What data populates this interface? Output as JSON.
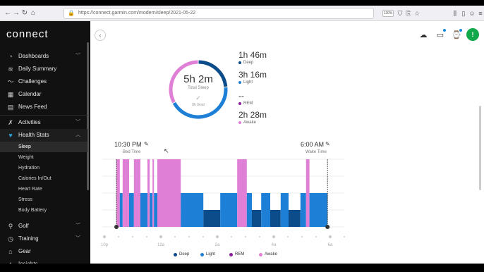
{
  "browser": {
    "url": "https://connect.garmin.com/modern/sleep/2021-05-22",
    "zoom": "130%"
  },
  "app": {
    "logo": "connect"
  },
  "sidebar": {
    "items": [
      {
        "label": "Dashboards",
        "icon": "gauge-icon",
        "glyph": "◔",
        "chevron": true
      },
      {
        "label": "Daily Summary",
        "icon": "layers-icon",
        "glyph": "≋",
        "chevron": false
      },
      {
        "label": "Challenges",
        "icon": "challenge-icon",
        "glyph": "〜",
        "chevron": false
      },
      {
        "label": "Calendar",
        "icon": "calendar-icon",
        "glyph": "▦",
        "chevron": false
      },
      {
        "label": "News Feed",
        "icon": "newsfeed-icon",
        "glyph": "▤",
        "chevron": false
      },
      {
        "label": "Activities",
        "icon": "runner-icon",
        "glyph": "✗",
        "chevron": true
      },
      {
        "label": "Health Stats",
        "icon": "heart-icon",
        "glyph": "♥",
        "chevron": true,
        "expanded": true
      }
    ],
    "health_sub": [
      "Sleep",
      "Weight",
      "Hydration",
      "Calories In/Out",
      "Heart Rate",
      "Stress",
      "Body Battery"
    ],
    "bottom_items": [
      {
        "label": "Golf",
        "icon": "golf-icon",
        "glyph": "⚲",
        "chevron": true
      },
      {
        "label": "Training",
        "icon": "stopwatch-icon",
        "glyph": "◷",
        "chevron": true
      },
      {
        "label": "Gear",
        "icon": "shoe-icon",
        "glyph": "⌂",
        "chevron": false
      },
      {
        "label": "Insights",
        "icon": "insights-icon",
        "glyph": "✦",
        "chevron": false
      }
    ]
  },
  "summary": {
    "total": "5h 2m",
    "total_label": "Total Sleep",
    "goal_label": "8h Goal",
    "stats": [
      {
        "value": "1h 46m",
        "label": "Deep",
        "color": "#0d4c8b"
      },
      {
        "value": "3h 16m",
        "label": "Light",
        "color": "#1e7fd6"
      },
      {
        "value": "--",
        "label": "REM",
        "color": "#8a1d9b"
      },
      {
        "value": "2h 28m",
        "label": "Awake",
        "color": "#e07fd6"
      }
    ],
    "ring": {
      "deep_min": 106,
      "light_min": 196,
      "rem_min": 0,
      "awake_min": 148
    }
  },
  "sleep_chart": {
    "bed_time": "10:30 PM",
    "bed_label": "Bed Time",
    "wake_time": "6:00 AM",
    "wake_label": "Wake Time",
    "x_ticks": [
      "10p",
      "12a",
      "2a",
      "4a",
      "6a"
    ],
    "legend": [
      {
        "label": "Deep",
        "color": "#0d4c8b"
      },
      {
        "label": "Light",
        "color": "#1e7fd6"
      },
      {
        "label": "REM",
        "color": "#8a1d9b"
      },
      {
        "label": "Awake",
        "color": "#e07fd6"
      }
    ]
  },
  "chart_data": {
    "type": "bar",
    "title": "",
    "x_unit": "hours after 10:00 PM",
    "stages": {
      "deep": 1,
      "light": 2,
      "rem": 3,
      "awake": 4
    },
    "segments": [
      {
        "start": 0.5,
        "end": 0.62,
        "stage": "awake"
      },
      {
        "start": 0.62,
        "end": 0.72,
        "stage": "light"
      },
      {
        "start": 0.72,
        "end": 0.95,
        "stage": "awake"
      },
      {
        "start": 0.95,
        "end": 1.12,
        "stage": "light"
      },
      {
        "start": 1.12,
        "end": 1.35,
        "stage": "awake"
      },
      {
        "start": 1.35,
        "end": 1.6,
        "stage": "light"
      },
      {
        "start": 1.6,
        "end": 1.68,
        "stage": "awake"
      },
      {
        "start": 1.68,
        "end": 1.78,
        "stage": "light"
      },
      {
        "start": 1.78,
        "end": 1.83,
        "stage": "awake"
      },
      {
        "start": 1.83,
        "end": 1.95,
        "stage": "light"
      },
      {
        "start": 1.95,
        "end": 2.78,
        "stage": "awake"
      },
      {
        "start": 2.78,
        "end": 3.58,
        "stage": "light"
      },
      {
        "start": 3.58,
        "end": 4.18,
        "stage": "deep"
      },
      {
        "start": 4.18,
        "end": 4.78,
        "stage": "light"
      },
      {
        "start": 4.78,
        "end": 5.12,
        "stage": "awake"
      },
      {
        "start": 5.12,
        "end": 5.3,
        "stage": "light"
      },
      {
        "start": 5.3,
        "end": 5.63,
        "stage": "deep"
      },
      {
        "start": 5.63,
        "end": 5.95,
        "stage": "light"
      },
      {
        "start": 5.95,
        "end": 6.32,
        "stage": "deep"
      },
      {
        "start": 6.32,
        "end": 6.6,
        "stage": "light"
      },
      {
        "start": 6.6,
        "end": 7.02,
        "stage": "deep"
      },
      {
        "start": 7.02,
        "end": 7.22,
        "stage": "light"
      },
      {
        "start": 7.22,
        "end": 7.34,
        "stage": "awake"
      },
      {
        "start": 7.34,
        "end": 7.98,
        "stage": "light"
      }
    ],
    "xlim": [
      0,
      8.5
    ]
  }
}
